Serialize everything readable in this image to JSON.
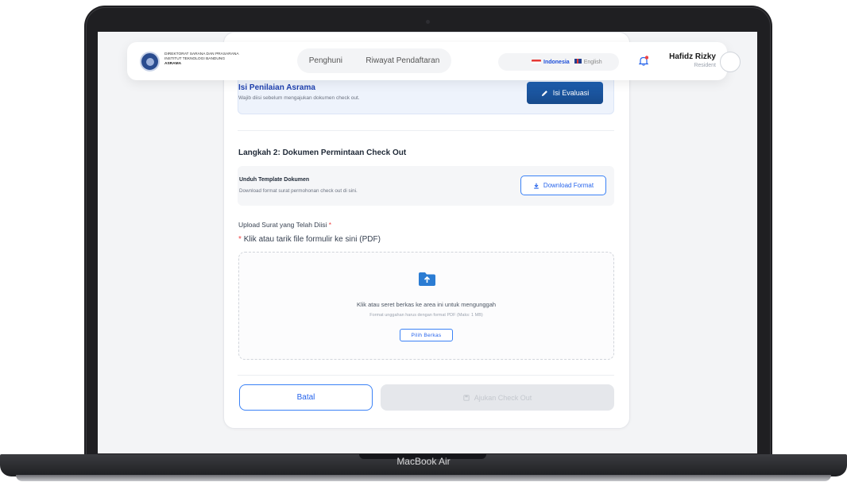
{
  "device": {
    "brand_label": "MacBook Air"
  },
  "navbar": {
    "logo": {
      "line1": "DIREKTORAT SARANA DAN PRASARANA",
      "line2": "INSTITUT TEKNOLOGI BANDUNG",
      "line3": "ASRAMA"
    },
    "tabs": [
      {
        "label": "Penghuni"
      },
      {
        "label": "Riwayat Pendaftaran"
      }
    ],
    "languages": [
      {
        "label": "Indonesia",
        "active": true,
        "flag": "flag-id-icon"
      },
      {
        "label": "English",
        "active": false,
        "flag": "flag-uk-icon"
      }
    ],
    "notification_icon": "bell-icon",
    "user": {
      "name": "Hafidz Rizky",
      "role": "Resident"
    }
  },
  "evaluation": {
    "title": "Isi Penilaian Asrama",
    "description": "Wajib diisi sebelum mengajukan dokumen check out.",
    "button_label": "Isi Evaluasi",
    "button_icon": "pencil-icon"
  },
  "step2": {
    "title": "Langkah 2: Dokumen Permintaan Check Out",
    "template": {
      "title": "Unduh Template Dokumen",
      "description": "Download format surat permohonan check out di sini.",
      "button_label": "Download Format",
      "button_icon": "download-icon"
    },
    "upload": {
      "label": "Upload Surat yang Telah Diisi",
      "required_mark": "*",
      "hint": "Klik atau tarik file formulir ke sini (PDF)",
      "dropzone_icon": "folder-upload-icon",
      "dropzone_main": "Klik atau seret berkas ke area ini untuk mengunggah",
      "dropzone_sub": "Format unggahan harus dengan format PDF (Maks: 1 MB)",
      "pick_button": "Pilih Berkas"
    }
  },
  "actions": {
    "cancel_label": "Batal",
    "submit_label": "Ajukan Check Out",
    "submit_icon": "save-icon",
    "submit_disabled": true
  },
  "colors": {
    "primary": "#2563eb",
    "primary_dark": "#174a8c",
    "required": "#ef4444",
    "disabled_bg": "#e5e7eb"
  }
}
